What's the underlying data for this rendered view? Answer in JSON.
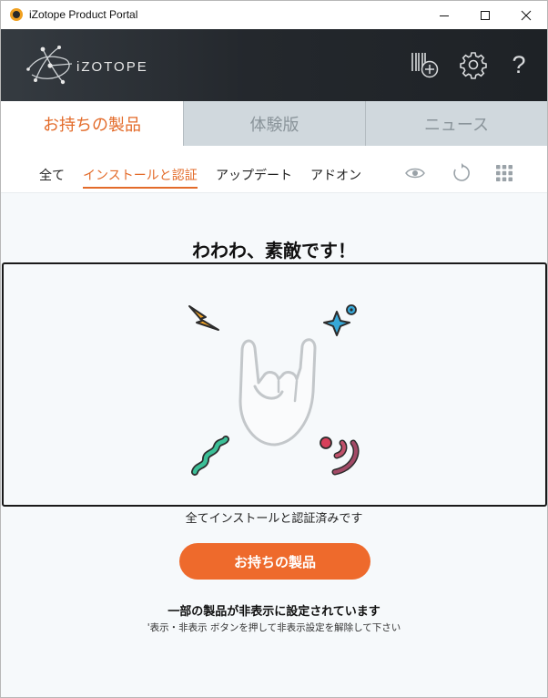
{
  "window": {
    "title": "iZotope Product Portal"
  },
  "header": {
    "brand": "iZOTOPE",
    "help_glyph": "?"
  },
  "main_tabs": [
    {
      "label": "お持ちの製品",
      "active": true
    },
    {
      "label": "体験版",
      "active": false
    },
    {
      "label": "ニュース",
      "active": false
    }
  ],
  "sub_tabs": [
    {
      "label": "全て",
      "active": false
    },
    {
      "label": "インストールと認証",
      "active": true
    },
    {
      "label": "アップデート",
      "active": false
    },
    {
      "label": "アドオン",
      "active": false
    }
  ],
  "content": {
    "heading": "わわわ、素敵です！",
    "status": "全てインストールと認証済みです",
    "cta_label": "お持ちの製品",
    "hidden_notice": "一部の製品が非表示に設定されています",
    "hidden_hint": "'表示・非表示 ボタンを押して非表示設定を解除して下さい"
  },
  "icons": {
    "app": "izotope-app-icon",
    "logo": "izotope-logo",
    "register": "register-product-icon",
    "settings": "gear-icon",
    "help": "help-icon",
    "show_hide": "eye-icon",
    "refresh": "refresh-icon",
    "grid": "grid-view-icon"
  },
  "colors": {
    "accent": "#e36b2a",
    "cta": "#ee6a2c",
    "header_bg": "#24282d",
    "tab_inactive_bg": "#d0d8dd"
  }
}
